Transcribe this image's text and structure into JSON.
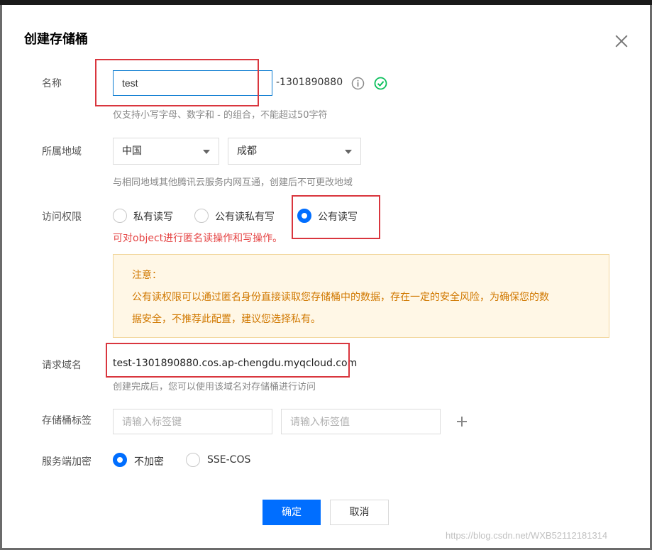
{
  "dialog": {
    "title": "创建存储桶"
  },
  "name_row": {
    "label": "名称",
    "value": "test",
    "suffix": "-1301890880",
    "hint": "仅支持小写字母、数字和 - 的组合，不能超过50字符"
  },
  "region_row": {
    "label": "所属地域",
    "country": "中国",
    "city": "成都",
    "hint": "与相同地域其他腾讯云服务内网互通，创建后不可更改地域"
  },
  "access_row": {
    "label": "访问权限",
    "options": [
      "私有读写",
      "公有读私有写",
      "公有读写"
    ],
    "selected": "公有读写",
    "hint": "可对object进行匿名读操作和写操作。"
  },
  "notice": {
    "title": "注意：",
    "line1": "公有读权限可以通过匿名身份直接读取您存储桶中的数据，存在一定的安全风险，为确保您的数",
    "line2": "据安全，不推荐此配置，建议您选择私有。"
  },
  "domain_row": {
    "label": "请求域名",
    "value": "test-1301890880.cos.ap-chengdu.myqcloud.com",
    "hint": "创建完成后，您可以使用该域名对存储桶进行访问"
  },
  "tags_row": {
    "label": "存储桶标签",
    "key_placeholder": "请输入标签键",
    "value_placeholder": "请输入标签值"
  },
  "encryption_row": {
    "label": "服务端加密",
    "options": [
      "不加密",
      "SSE-COS"
    ],
    "selected": "不加密"
  },
  "footer": {
    "confirm_label": "确定",
    "cancel_label": "取消"
  },
  "watermark": "https://blog.csdn.net/WXB52112181314",
  "colors": {
    "primary": "#006eff",
    "annotation_red": "#d9363e",
    "notice_text": "#d07800",
    "success_green": "#0abf5b"
  }
}
